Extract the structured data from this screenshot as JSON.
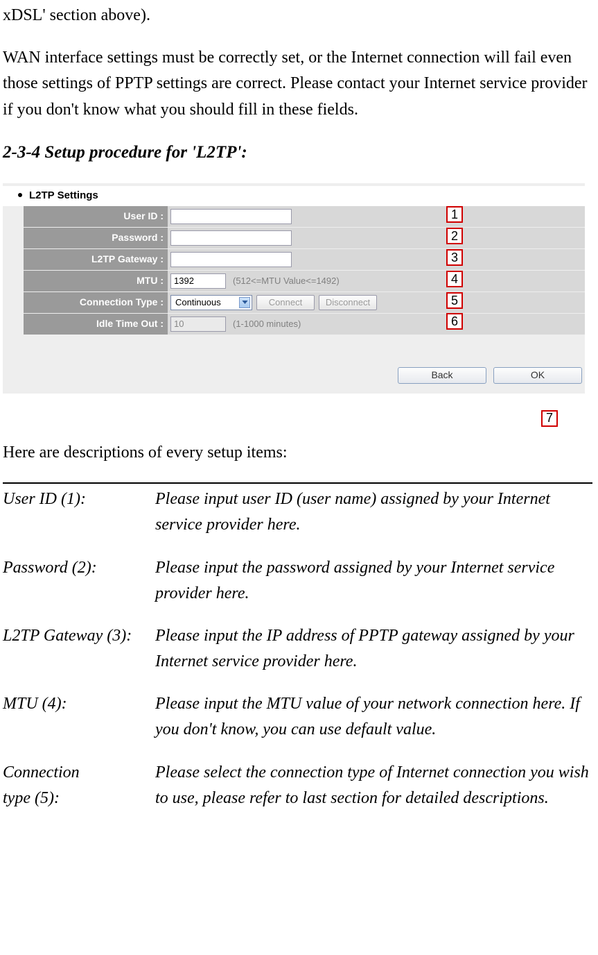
{
  "intro": {
    "fragment": "xDSL' section above).",
    "paragraph": "WAN interface settings must be correctly set, or the Internet connection will fail even those settings of PPTP settings are correct. Please contact your Internet service provider if you don't know what you should fill in these fields."
  },
  "heading": "2-3-4 Setup procedure for 'L2TP':",
  "figure": {
    "bullet_title": "L2TP Settings",
    "rows": {
      "user_id": {
        "label": "User ID :",
        "value": ""
      },
      "password": {
        "label": "Password :",
        "value": ""
      },
      "gateway": {
        "label": "L2TP Gateway :",
        "value": ""
      },
      "mtu": {
        "label": "MTU :",
        "value": "1392",
        "hint": "(512<=MTU Value<=1492)"
      },
      "conn_type": {
        "label": "Connection Type :",
        "value": "Continuous",
        "connect": "Connect",
        "disconnect": "Disconnect"
      },
      "idle": {
        "label": "Idle Time Out :",
        "value": "10",
        "hint": "(1-1000 minutes)"
      }
    },
    "buttons": {
      "back": "Back",
      "ok": "OK"
    },
    "callouts": {
      "c1": "1",
      "c2": "2",
      "c3": "3",
      "c4": "4",
      "c5": "5",
      "c6": "6",
      "c7": "7"
    }
  },
  "descriptions_intro": "Here are descriptions of every setup items:",
  "definitions": {
    "user_id": {
      "term": "User ID (1):",
      "desc": "Please input user ID (user name) assigned by your Internet service provider here."
    },
    "password": {
      "term": "Password (2):",
      "desc": "Please input the password assigned by your Internet service provider here."
    },
    "gateway": {
      "term": "L2TP Gateway (3):",
      "desc": "Please input the IP address of PPTP gateway assigned by your Internet service provider here."
    },
    "mtu": {
      "term": "MTU (4):",
      "desc": "Please input the MTU value of your network connection here. If you don't know, you can use default value."
    },
    "conn_type": {
      "term1": "Connection",
      "term2": "type (5):",
      "desc": "Please select the connection type of Internet connection you wish to use, please refer to last section for detailed descriptions."
    }
  }
}
